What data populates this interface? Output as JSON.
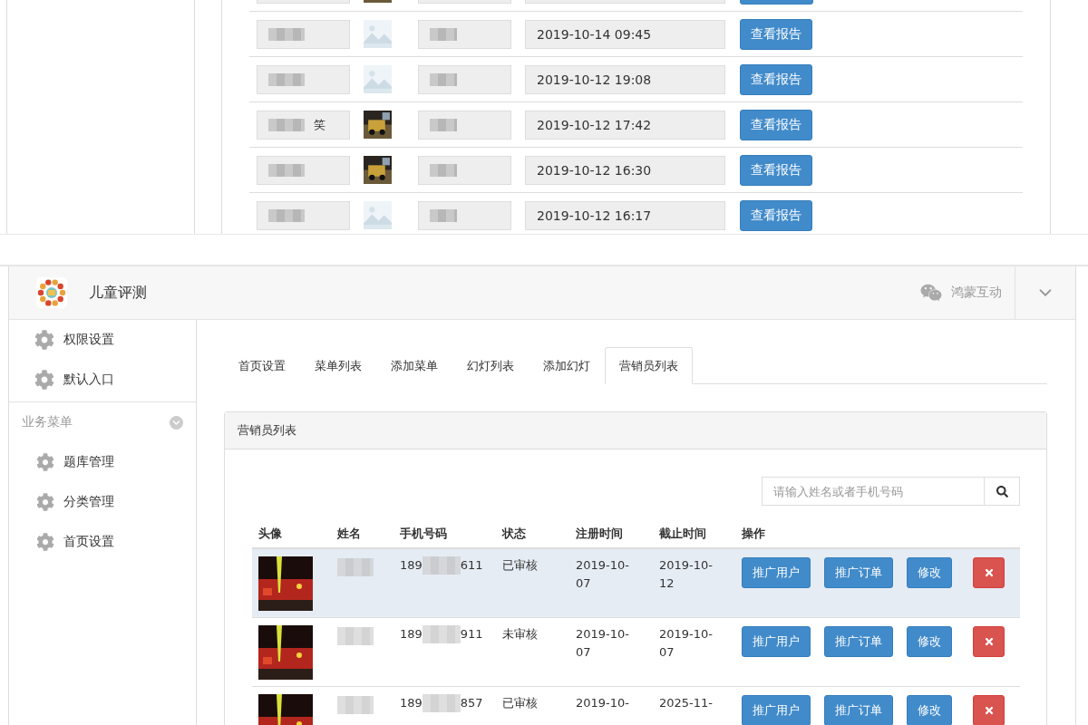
{
  "report_list": {
    "rows": [
      {
        "kind": "cut"
      },
      {
        "kind": "full",
        "date": "2019-10-14 09:45",
        "button": "查看报告"
      },
      {
        "kind": "full",
        "date": "2019-10-12 19:08",
        "button": "查看报告"
      },
      {
        "kind": "full",
        "name": "笑",
        "date": "2019-10-12 17:42",
        "button": "查看报告"
      },
      {
        "kind": "full",
        "date": "2019-10-12 16:30",
        "button": "查看报告"
      },
      {
        "kind": "full",
        "date": "2019-10-12 16:17",
        "button": "查看报告"
      }
    ]
  },
  "app": {
    "title": "儿童评测",
    "account": "鸿蒙互动"
  },
  "sidebar": {
    "items": [
      {
        "label": "权限设置"
      },
      {
        "label": "默认入口"
      }
    ],
    "section": {
      "label": "业务菜单",
      "expanded": true,
      "items": [
        {
          "label": "题库管理"
        },
        {
          "label": "分类管理"
        },
        {
          "label": "首页设置"
        }
      ]
    }
  },
  "tabs": [
    {
      "label": "首页设置",
      "selected": false
    },
    {
      "label": "菜单列表",
      "selected": false
    },
    {
      "label": "添加菜单",
      "selected": false
    },
    {
      "label": "幻灯列表",
      "selected": false
    },
    {
      "label": "添加幻灯",
      "selected": false
    },
    {
      "label": "营销员列表",
      "selected": true
    }
  ],
  "panel": {
    "title": "营销员列表",
    "search": {
      "placeholder": "请输入姓名或者手机号码"
    },
    "table": {
      "columns": [
        "头像",
        "姓名",
        "手机号码",
        "状态",
        "注册时间",
        "截止时间",
        "操作"
      ],
      "rows": [
        {
          "selected": true,
          "phone_start": "189",
          "phone_end": "611",
          "status": "已审核",
          "registered": "2019-10-07",
          "expires": "2019-10-12",
          "actions": [
            "推广用户",
            "推广订单",
            "修改"
          ]
        },
        {
          "selected": false,
          "phone_start": "189",
          "phone_end": "911",
          "status": "未审核",
          "registered": "2019-10-07",
          "expires": "2019-10-07",
          "actions": [
            "推广用户",
            "推广订单",
            "修改"
          ]
        },
        {
          "selected": false,
          "phone_start": "189",
          "phone_end": "857",
          "status": "已审核",
          "registered": "2019-10-",
          "expires": "2025-11-",
          "actions": [
            "推广用户",
            "推广订单",
            "修改"
          ]
        }
      ]
    }
  }
}
